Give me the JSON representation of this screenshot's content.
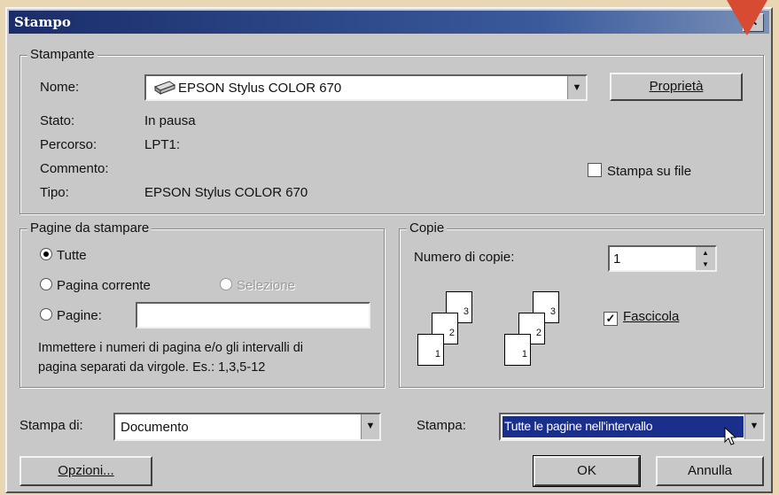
{
  "title": "Stampo",
  "stampante": {
    "legend": "Stampante",
    "nome_label": "Nome:",
    "nome_value": "EPSON Stylus COLOR 670",
    "proprieta": "Proprietà",
    "stato_label": "Stato:",
    "stato_value": "In pausa",
    "percorso_label": "Percorso:",
    "percorso_value": "LPT1:",
    "commento_label": "Commento:",
    "tipo_label": "Tipo:",
    "tipo_value": "EPSON Stylus COLOR 670",
    "stampa_su_file": "Stampa su file"
  },
  "pagine": {
    "legend": "Pagine da stampare",
    "tutte": "Tutte",
    "pagina_corrente": "Pagina corrente",
    "selezione": "Selezione",
    "pagine": "Pagine:",
    "pagine_value": "",
    "help_line1": "Immettere i numeri di pagina e/o gli intervalli di",
    "help_line2": "pagina separati da virgole. Es.: 1,3,5-12"
  },
  "copie": {
    "legend": "Copie",
    "numero_label": "Numero di copie:",
    "numero_value": "1",
    "fascicola": "Fascicola",
    "page_numbers": [
      "1",
      "2",
      "3"
    ]
  },
  "stampa_di": {
    "label": "Stampa di:",
    "value": "Documento"
  },
  "stampa": {
    "label": "Stampa:",
    "value": "Tutte le pagine nell'intervallo"
  },
  "buttons": {
    "opzioni": "Opzioni...",
    "ok": "OK",
    "annulla": "Annulla"
  },
  "icons": {
    "close": "✕",
    "dropdown": "▼",
    "check": "✓"
  }
}
